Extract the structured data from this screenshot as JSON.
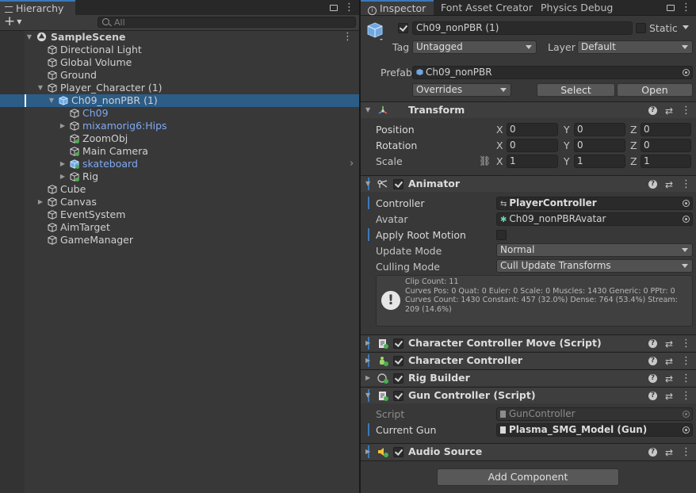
{
  "hierarchy": {
    "tab_label": "Hierarchy",
    "add_label": "+",
    "search_placeholder": "All",
    "scene": "SampleScene",
    "items": [
      {
        "label": "Directional Light",
        "depth": 1,
        "arrow": "",
        "blue": false
      },
      {
        "label": "Global Volume",
        "depth": 1,
        "arrow": "",
        "blue": false
      },
      {
        "label": "Ground",
        "depth": 1,
        "arrow": "",
        "blue": false
      },
      {
        "label": "Player_Character (1)",
        "depth": 1,
        "arrow": "open",
        "blue": false
      },
      {
        "label": "Ch09_nonPBR (1)",
        "depth": 2,
        "arrow": "open",
        "blue": false,
        "selected": true
      },
      {
        "label": "Ch09",
        "depth": 3,
        "arrow": "",
        "blue": true
      },
      {
        "label": "mixamorig6:Hips",
        "depth": 3,
        "arrow": "closed",
        "blue": true
      },
      {
        "label": "ZoomObj",
        "depth": 3,
        "arrow": "",
        "blue": false
      },
      {
        "label": "Main Camera",
        "depth": 3,
        "arrow": "",
        "blue": false
      },
      {
        "label": "skateboard",
        "depth": 3,
        "arrow": "closed",
        "blue": true
      },
      {
        "label": "Rig",
        "depth": 3,
        "arrow": "closed",
        "blue": false
      },
      {
        "label": "Cube",
        "depth": 1,
        "arrow": "",
        "blue": false
      },
      {
        "label": "Canvas",
        "depth": 1,
        "arrow": "closed",
        "blue": false
      },
      {
        "label": "EventSystem",
        "depth": 1,
        "arrow": "",
        "blue": false
      },
      {
        "label": "AimTarget",
        "depth": 1,
        "arrow": "",
        "blue": false
      },
      {
        "label": "GameManager",
        "depth": 1,
        "arrow": "",
        "blue": false
      }
    ]
  },
  "tabs": {
    "inspector": "Inspector",
    "font_asset_creator": "Font Asset Creator",
    "physics_debug": "Physics Debug"
  },
  "object": {
    "name": "Ch09_nonPBR (1)",
    "static_label": "Static",
    "tag_label": "Tag",
    "tag_value": "Untagged",
    "layer_label": "Layer",
    "layer_value": "Default",
    "prefab_label": "Prefab",
    "prefab_value": "Ch09_nonPBR",
    "overrides_label": "Overrides",
    "select_label": "Select",
    "open_label": "Open"
  },
  "transform": {
    "title": "Transform",
    "position_label": "Position",
    "rotation_label": "Rotation",
    "scale_label": "Scale",
    "x": "X",
    "y": "Y",
    "z": "Z",
    "position": [
      "0",
      "0",
      "0"
    ],
    "rotation": [
      "0",
      "0",
      "0"
    ],
    "scale": [
      "1",
      "1",
      "1"
    ]
  },
  "animator": {
    "title": "Animator",
    "controller_label": "Controller",
    "controller_value": "PlayerController",
    "avatar_label": "Avatar",
    "avatar_value": "Ch09_nonPBRAvatar",
    "apply_root_motion_label": "Apply Root Motion",
    "update_mode_label": "Update Mode",
    "update_mode_value": "Normal",
    "culling_mode_label": "Culling Mode",
    "culling_mode_value": "Cull Update Transforms",
    "info_lines": [
      "Clip Count: 11",
      "Curves Pos: 0 Quat: 0 Euler: 0 Scale: 0 Muscles: 1430 Generic: 0 PPtr: 0",
      "Curves Count: 1430 Constant: 457 (32.0%) Dense: 764 (53.4%) Stream: 209 (14.6%)"
    ]
  },
  "components": {
    "char_move": "Character Controller Move (Script)",
    "char_controller": "Character Controller",
    "rig_builder": "Rig Builder",
    "gun_controller": "Gun Controller (Script)",
    "audio_source": "Audio Source"
  },
  "gun": {
    "script_label": "Script",
    "script_value": "GunController",
    "current_gun_label": "Current Gun",
    "current_gun_value": "Plasma_SMG_Model (Gun)"
  },
  "add_component_label": "Add Component",
  "colors": {
    "selection": "#2c5d87",
    "accent": "#3a79bb",
    "prefab_blue": "#7ea9f2",
    "panel_bg": "#383838"
  }
}
